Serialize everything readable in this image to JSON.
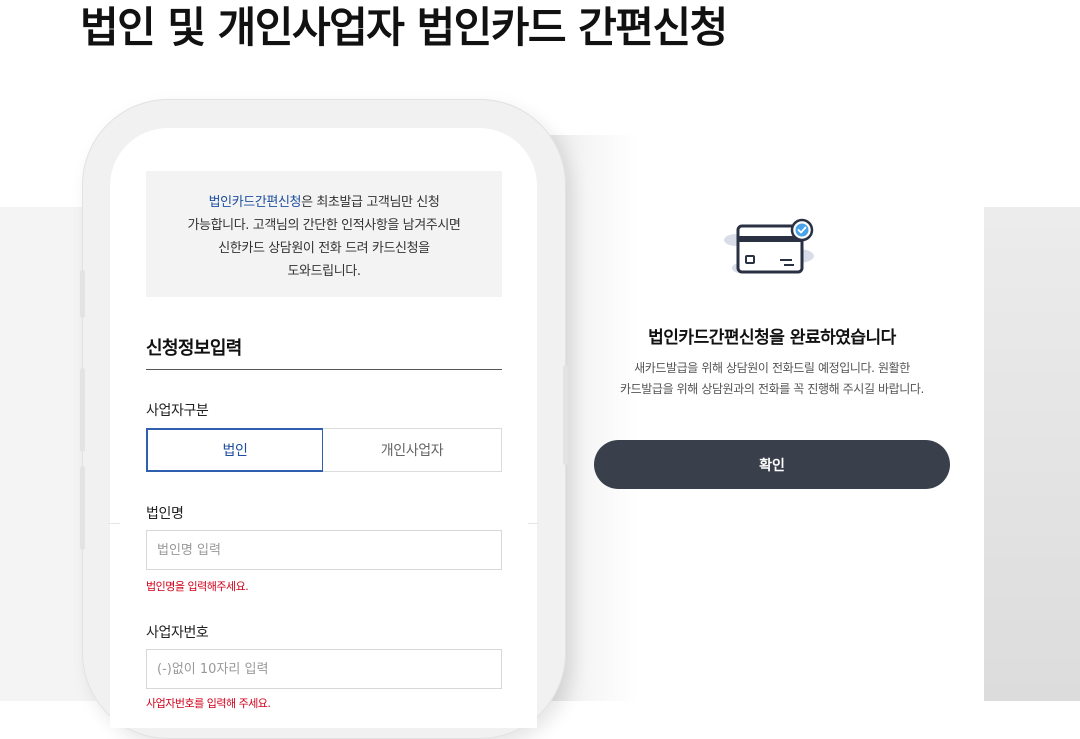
{
  "page": {
    "title": "법인 및 개인사업자 법인카드 간편신청"
  },
  "form": {
    "notice": {
      "highlight": "법인카드간편신청",
      "line1_rest": "은 최초발급 고객님만 신청",
      "line2": "가능합니다. 고객님의 간단한 인적사항을 남겨주시면",
      "line3": "신한카드 상담원이 전화 드려 카드신청을",
      "line4": "도와드립니다."
    },
    "section_title": "신청정보입력",
    "business_type": {
      "label": "사업자구분",
      "options": [
        "법인",
        "개인사업자"
      ],
      "selected": "법인"
    },
    "corp_name": {
      "label": "법인명",
      "placeholder": "법인명 입력",
      "value": "",
      "error": "법인명을 입력해주세요."
    },
    "biz_number": {
      "label": "사업자번호",
      "placeholder": "(-)없이 10자리 입력",
      "value": "",
      "error": "사업자번호를 입력해 주세요."
    }
  },
  "completion": {
    "icon": "credit-card-check-icon",
    "title": "법인카드간편신청을 완료하였습니다",
    "desc_line1": "새카드발급을 위해 상담원이 전화드릴 예정입니다. 원활한",
    "desc_line2": "카드발급을 위해 상담원과의 전화를 꼭 진행해 주시길 바랍니다.",
    "confirm_label": "확인"
  },
  "colors": {
    "accent": "#1f4fa0",
    "error": "#d0021b",
    "button": "#3a404b"
  }
}
